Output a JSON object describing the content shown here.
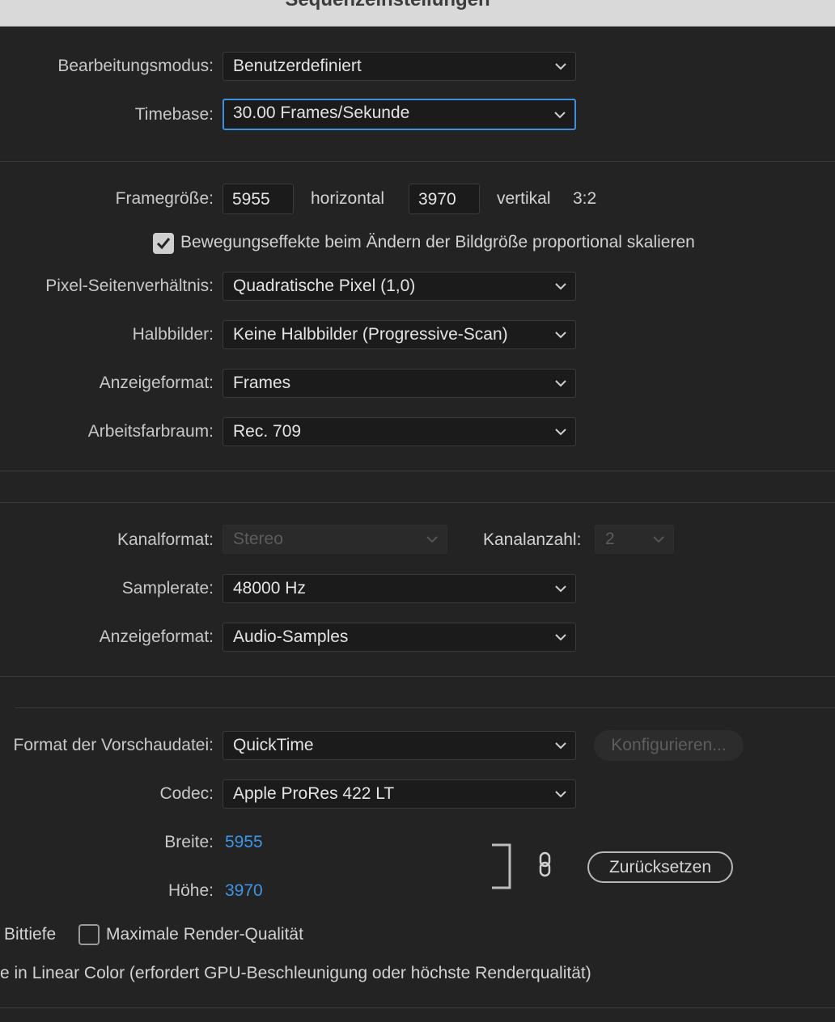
{
  "window": {
    "title": "Sequenzeinstellungen"
  },
  "video": {
    "editing_mode": {
      "label": "Bearbeitungsmodus:",
      "value": "Benutzerdefiniert"
    },
    "timebase": {
      "label": "Timebase:",
      "value": "30.00  Frames/Sekunde"
    },
    "frame_size": {
      "label": "Framegröße:",
      "width": "5955",
      "horizontal_label": "horizontal",
      "height": "3970",
      "vertical_label": "vertikal",
      "ratio": "3:2"
    },
    "scale_motion": {
      "label": "Bewegungseffekte beim Ändern der Bildgröße proportional skalieren",
      "checked": true
    },
    "pixel_aspect": {
      "label": "Pixel-Seitenverhältnis:",
      "value": "Quadratische Pixel (1,0)"
    },
    "fields": {
      "label": "Halbbilder:",
      "value": "Keine Halbbilder (Progressive-Scan)"
    },
    "display_format": {
      "label": "Anzeigeformat:",
      "value": "Frames"
    },
    "color_space": {
      "label": "Arbeitsfarbraum:",
      "value": "Rec. 709"
    }
  },
  "audio": {
    "channel_format": {
      "label": "Kanalformat:",
      "value": "Stereo"
    },
    "channel_count": {
      "label": "Kanalanzahl:",
      "value": "2"
    },
    "sample_rate": {
      "label": "Samplerate:",
      "value": "48000 Hz"
    },
    "display_format": {
      "label": "Anzeigeformat:",
      "value": "Audio-Samples"
    }
  },
  "preview": {
    "file_format": {
      "label": "Format der Vorschaudatei:",
      "value": "QuickTime"
    },
    "configure_button": "Konfigurieren...",
    "codec": {
      "label": "Codec:",
      "value": "Apple ProRes 422 LT"
    },
    "width": {
      "label": "Breite:",
      "value": "5955"
    },
    "height": {
      "label": "Höhe:",
      "value": "3970"
    },
    "reset_button": "Zurücksetzen"
  },
  "options": {
    "bit_depth_label": "Bittiefe",
    "max_render_quality": {
      "label": "Maximale Render-Qualität",
      "checked": false
    },
    "linear_color_label": "e in Linear Color (erfordert GPU-Beschleunigung oder höchste Renderqualität)"
  },
  "colors": {
    "accent": "#3f8fdc",
    "link": "#3d95e6",
    "background": "#232323"
  }
}
